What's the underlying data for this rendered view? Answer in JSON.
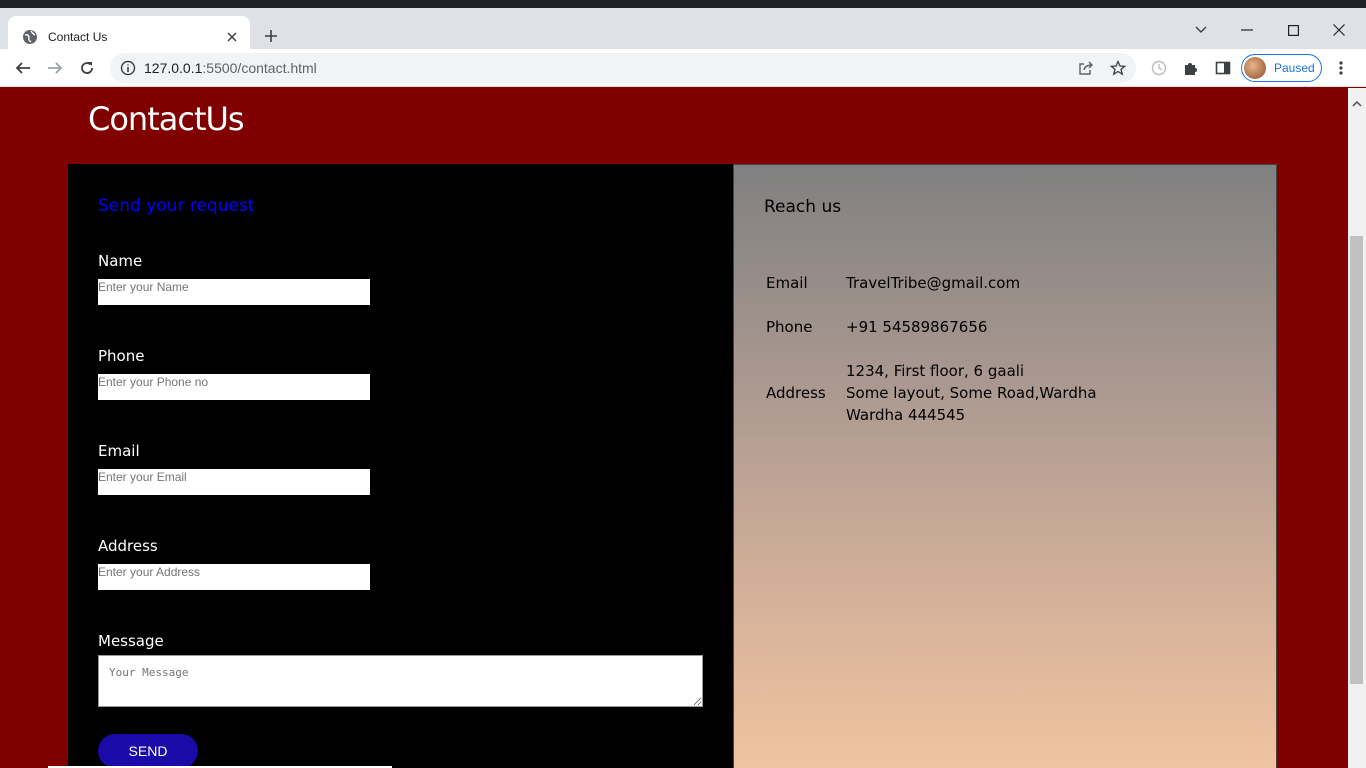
{
  "browser": {
    "tab_title": "Contact Us",
    "url_host": "127.0.0.1",
    "url_rest": ":5500/contact.html",
    "profile_label": "Paused"
  },
  "page": {
    "title": "ContactUs"
  },
  "form": {
    "heading": "Send your request",
    "name_label": "Name",
    "name_placeholder": "Enter your Name",
    "phone_label": "Phone",
    "phone_placeholder": "Enter your Phone no",
    "email_label": "Email",
    "email_placeholder": "Enter your Email",
    "address_label": "Address",
    "address_placeholder": "Enter your Address",
    "message_label": "Message",
    "message_placeholder": "Your Message",
    "send_label": "SEND"
  },
  "reach": {
    "heading": "Reach us",
    "email_label": "Email",
    "email_value": "TravelTribe@gmail.com",
    "phone_label": "Phone",
    "phone_value": "+91 54589867656",
    "address_label": "Address",
    "address_line1": "1234, First floor, 6 gaali",
    "address_line2": "Some layout, Some Road,Wardha",
    "address_line3": "Wardha 444545"
  },
  "colors": {
    "page_bg": "#800000",
    "form_heading": "#0000ff",
    "send_button": "#1a0aa8"
  }
}
